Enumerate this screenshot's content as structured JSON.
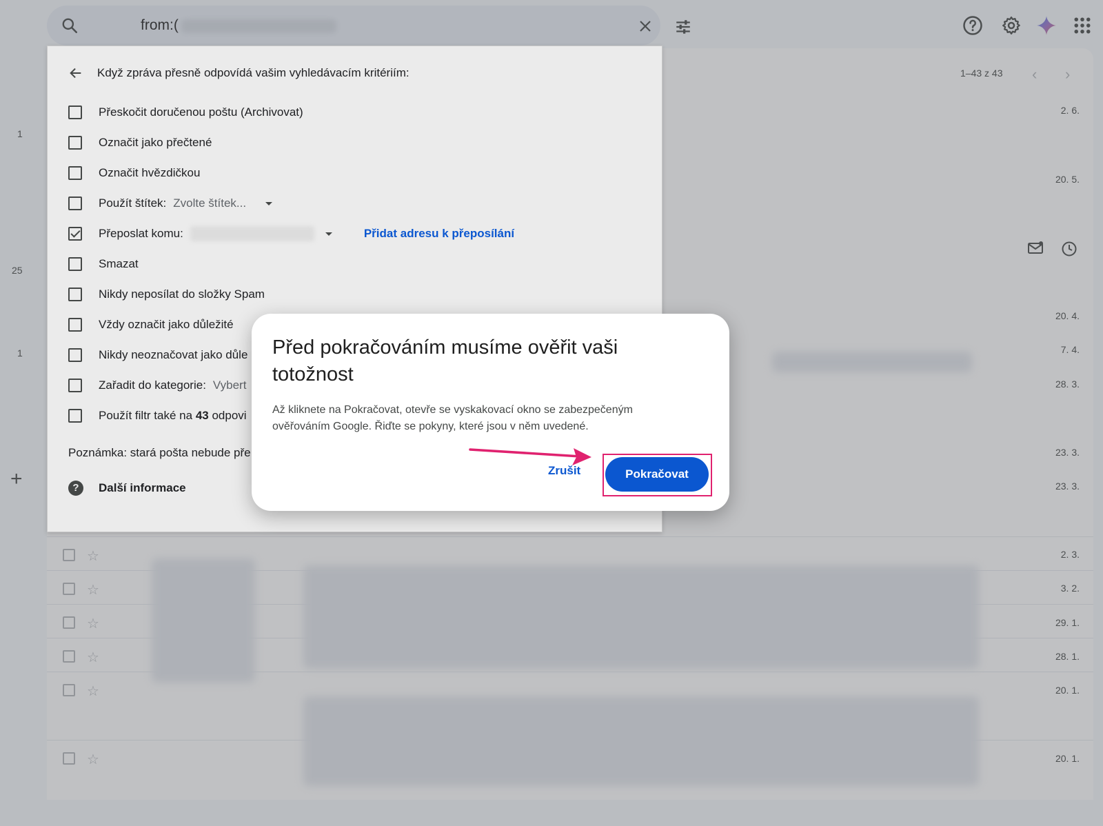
{
  "search": {
    "query": "from:("
  },
  "pager": {
    "text": "1–43 z 43"
  },
  "left_counts": [
    "1",
    "25",
    "1"
  ],
  "list_dates": [
    "2. 6.",
    "20. 5.",
    "20. 4.",
    "7. 4.",
    "28. 3.",
    "23. 3.",
    "23. 3.",
    "2. 3.",
    "3. 2.",
    "29. 1.",
    "28. 1.",
    "20. 1.",
    "20. 1."
  ],
  "filter": {
    "header": "Když zpráva přesně odpovídá vašim vyhledávacím kritériím:",
    "options": [
      {
        "label": "Přeskočit doručenou poštu (Archivovat)",
        "checked": false
      },
      {
        "label": "Označit jako přečtené",
        "checked": false
      },
      {
        "label": "Označit hvězdičkou",
        "checked": false
      },
      {
        "label": "Použít štítek:",
        "checked": false,
        "select": "Zvolte štítek..."
      },
      {
        "label": "Přeposlat komu:",
        "checked": true,
        "link": "Přidat adresu k přeposílání"
      },
      {
        "label": "Smazat",
        "checked": false
      },
      {
        "label": "Nikdy neposílat do složky Spam",
        "checked": false
      },
      {
        "label": "Vždy označit jako důležité",
        "checked": false
      },
      {
        "label": "Nikdy neoznačovat jako důle",
        "checked": false
      },
      {
        "label": "Zařadit do kategorie:",
        "checked": false,
        "select": "Vybert"
      },
      {
        "label": "Použít filtr také na",
        "count": "43",
        "suffix": "odpovi",
        "checked": false
      }
    ],
    "note": "Poznámka: stará pošta nebude pře",
    "more_info": "Další informace"
  },
  "dialog": {
    "title": "Před pokračováním musíme ověřit vaši totožnost",
    "body": "Až kliknete na Pokračovat, otevře se vyskakovací okno se zabezpečeným ověřováním Google. Řiďte se pokyny, které jsou v něm uvedené.",
    "cancel": "Zrušit",
    "continue": "Pokračovat"
  },
  "colors": {
    "accent": "#0b57d0",
    "highlight": "#e0226f"
  },
  "icons": [
    "search-icon",
    "close-icon",
    "tune-icon",
    "help-icon",
    "settings-icon",
    "gemini-icon",
    "apps-icon",
    "back-arrow-icon",
    "help-filled-icon",
    "plus-icon",
    "mail-icon",
    "clock-icon"
  ]
}
